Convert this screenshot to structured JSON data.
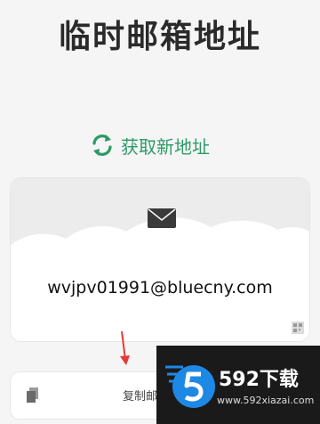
{
  "page": {
    "title": "临时邮箱地址"
  },
  "refresh": {
    "label": "获取新地址",
    "icon": "refresh-icon",
    "color": "#2d9a68"
  },
  "email_card": {
    "address": "wvjpv01991@bluecny.com",
    "icon": "mail-icon"
  },
  "copy_button": {
    "label": "复制邮",
    "icon": "copy-icon"
  },
  "watermark": {
    "brand": "592下载",
    "url": "www.592xiazai.com"
  }
}
